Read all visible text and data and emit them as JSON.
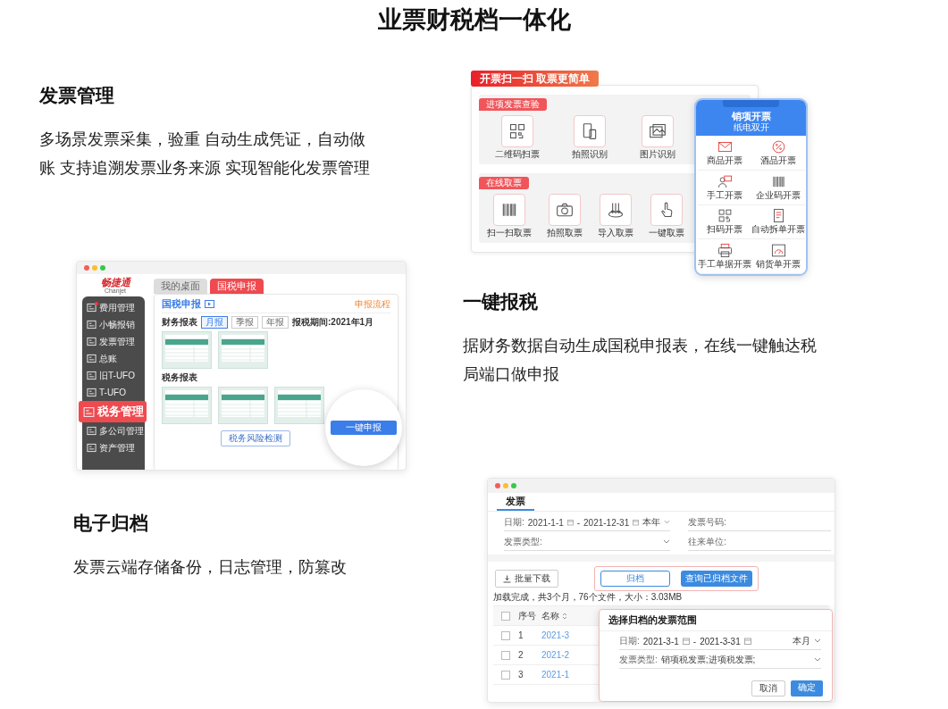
{
  "page_title": "业票财税档一体化",
  "features": [
    {
      "heading": "发票管理",
      "description": "多场景发票采集，验重 自动生成凭证，自动做账 支持追溯发票业务来源 实现智能化发票管理"
    },
    {
      "heading": "一键报税",
      "description": "据财务数据自动生成国税申报表，在线一键触达税局端口做申报"
    },
    {
      "heading": "电子归档",
      "description": "发票云端存储备份，日志管理，防篡改"
    }
  ],
  "scan_panel": {
    "banner": "开票扫一扫 取票更简单",
    "groups": [
      {
        "title": "进项发票查验",
        "items": [
          "二维码扫票",
          "拍照识别",
          "图片识别"
        ]
      },
      {
        "title": "在线取票",
        "items": [
          "扫一扫取票",
          "拍照取票",
          "导入取票",
          "一键取票"
        ]
      }
    ],
    "phone": {
      "title": "销项开票",
      "subtitle": "纸电双开",
      "items": [
        "商品开票",
        "酒品开票",
        "手工开票",
        "企业码开票",
        "扫码开票",
        "自动拆单开票",
        "手工单据开票",
        "销货单开票"
      ]
    }
  },
  "tax_window": {
    "logo": "畅捷通",
    "logo_subtitle": "Chanjet",
    "sidebar": [
      {
        "label": "费用管理",
        "selected": false,
        "unread": true
      },
      {
        "label": "小畅报销",
        "selected": false,
        "unread": false
      },
      {
        "label": "发票管理",
        "selected": false,
        "unread": false
      },
      {
        "label": "总账",
        "selected": false,
        "unread": false
      },
      {
        "label": "旧T-UFO",
        "selected": false,
        "unread": false
      },
      {
        "label": "T-UFO",
        "selected": false,
        "unread": false
      },
      {
        "label": "税务管理",
        "selected": true,
        "unread": false
      },
      {
        "label": "多公司管理",
        "selected": false,
        "unread": false
      },
      {
        "label": "资产管理",
        "selected": false,
        "unread": false
      }
    ],
    "tabs": [
      {
        "label": "我的桌面",
        "selected": false
      },
      {
        "label": "国税申报",
        "selected": true
      }
    ],
    "panel_title": "国税申报",
    "process_link": "申报流程",
    "financial_label": "财务报表",
    "periods": [
      {
        "label": "月报",
        "selected": true
      },
      {
        "label": "季报",
        "selected": false
      },
      {
        "label": "年报",
        "selected": false
      }
    ],
    "period_text": "报税期间:2021年1月",
    "tax_label": "税务报表",
    "risk_button": "税务风险检测",
    "submit_button": "一键申报"
  },
  "archive_window": {
    "tab": "发票",
    "date_label": "日期:",
    "date_from": "2021-1-1",
    "date_separator": "-",
    "date_to": "2021-12-31",
    "range": "本年",
    "invoice_no_label": "发票号码:",
    "type_label": "发票类型:",
    "partner_label": "往来单位:",
    "download_button": "批量下载",
    "archive_button": "归档",
    "query_button": "查询已归档文件",
    "status": "加载完成，共3个月，76个文件，大小：3.03MB",
    "select_all_checked": false,
    "columns": [
      "序号",
      "名称"
    ],
    "rows": [
      {
        "index": "1",
        "name": "2021-3",
        "checked": false
      },
      {
        "index": "2",
        "name": "2021-2",
        "checked": false
      },
      {
        "index": "3",
        "name": "2021-1",
        "checked": false
      }
    ],
    "dialog": {
      "title": "选择归档的发票范围",
      "date_label": "日期:",
      "date_from": "2021-3-1",
      "date_separator": "-",
      "date_to": "2021-3-31",
      "range": "本月",
      "type_label": "发票类型:",
      "type_value": "销项税发票;进项税发票;",
      "cancel": "取消",
      "confirm": "确定"
    }
  }
}
